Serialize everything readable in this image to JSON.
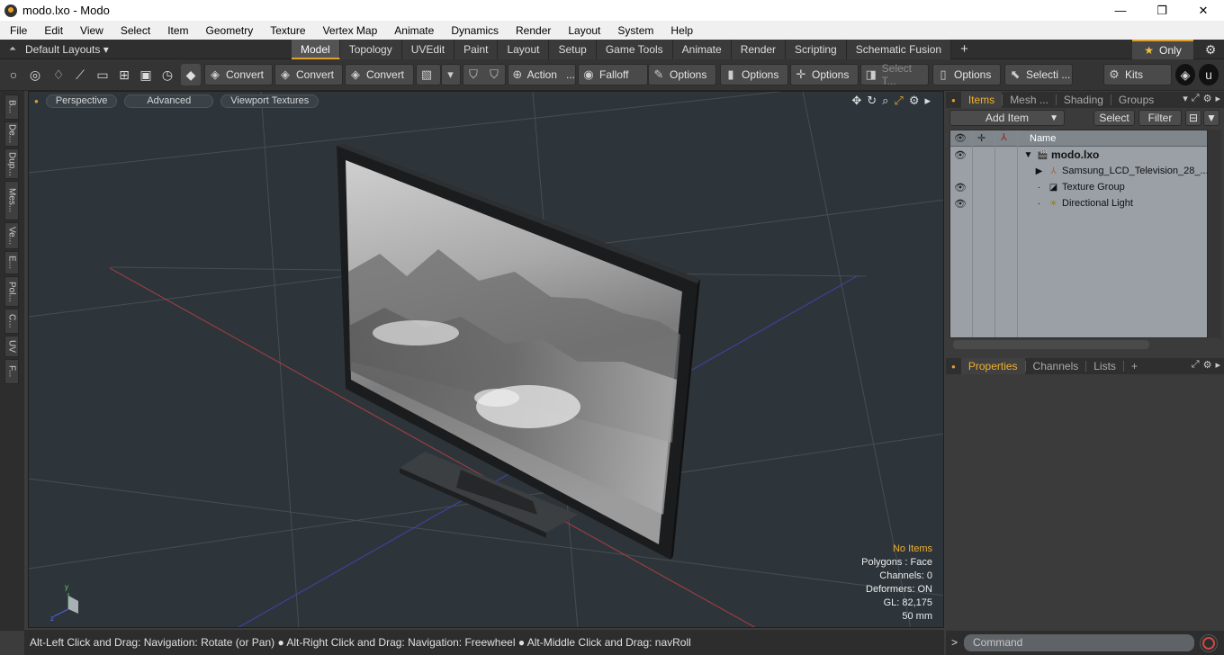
{
  "window": {
    "title": "modo.lxo - Modo",
    "minimize": "—",
    "maximize": "❐",
    "close": "✕"
  },
  "menu": [
    "File",
    "Edit",
    "View",
    "Select",
    "Item",
    "Geometry",
    "Texture",
    "Vertex Map",
    "Animate",
    "Dynamics",
    "Render",
    "Layout",
    "System",
    "Help"
  ],
  "layoutbar": {
    "layout_selector": "Default Layouts ▾",
    "tabs": [
      "Model",
      "Topology",
      "UVEdit",
      "Paint",
      "Layout",
      "Setup",
      "Game Tools",
      "Animate",
      "Render",
      "Scripting",
      "Schematic Fusion"
    ],
    "active_tab": "Model",
    "add_tab": "+",
    "only_label": "Only"
  },
  "toolbar": {
    "convert1": "Convert",
    "convert2": "Convert",
    "convert3": "Convert",
    "action": "Action",
    "action_more": "...",
    "falloff": "Falloff",
    "options1": "Options",
    "options2": "Options",
    "options3": "Options",
    "options4": "Options",
    "select_t": "Select T...",
    "selecti": "Selecti ...",
    "kits": "Kits"
  },
  "left_tabs": [
    "B...",
    "De...",
    "Dup...",
    "Mes...",
    "Ve...",
    "E...",
    "Pol...",
    "C...",
    "UV",
    "F..."
  ],
  "viewport": {
    "view_mode": "Perspective",
    "advanced": "Advanced",
    "textures": "Viewport Textures",
    "stats": {
      "selection": "No Items",
      "polygons": "Polygons : Face",
      "channels": "Channels: 0",
      "deformers": "Deformers: ON",
      "gl": "GL: 82,175",
      "focal": "50 mm"
    }
  },
  "status": "Alt-Left Click and Drag: Navigation: Rotate (or Pan) ● Alt-Right Click and Drag: Navigation: Freewheel ● Alt-Middle Click and Drag: navRoll",
  "items_panel": {
    "tabs": [
      "Items",
      "Mesh ...",
      "Shading",
      "Groups"
    ],
    "active": "Items",
    "add_item": "Add Item",
    "select": "Select",
    "filter": "Filter",
    "col_name": "Name",
    "rows": [
      {
        "label": "modo.lxo",
        "bold": true
      },
      {
        "label": "Samsung_LCD_Television_28_..."
      },
      {
        "label": "Texture Group"
      },
      {
        "label": "Directional Light"
      }
    ]
  },
  "properties_panel": {
    "tabs": [
      "Properties",
      "Channels",
      "Lists"
    ],
    "active": "Properties",
    "add": "+"
  },
  "command": {
    "placeholder": "Command",
    "prompt": ">"
  },
  "colors": {
    "accent": "#e0a030",
    "viewport_bg": "#2e353a",
    "list_bg": "#9aa0a6"
  }
}
